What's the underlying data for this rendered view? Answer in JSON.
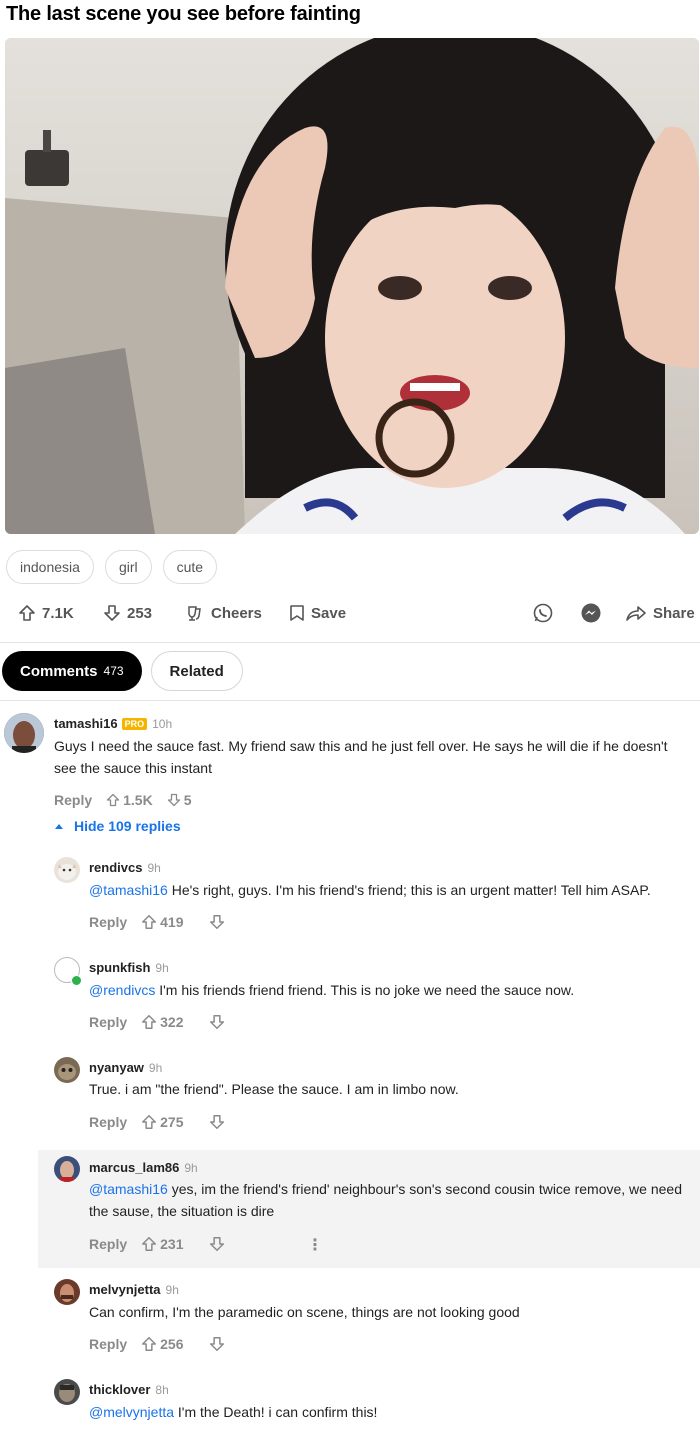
{
  "post": {
    "title": "The last scene you see before fainting",
    "tags": [
      "indonesia",
      "girl",
      "cute"
    ]
  },
  "actions": {
    "upvotes": "7.1K",
    "downvotes": "253",
    "cheers_label": "Cheers",
    "save_label": "Save",
    "share_label": "Share"
  },
  "tabs": {
    "comments_label": "Comments",
    "comments_count": "473",
    "related_label": "Related"
  },
  "comments": [
    {
      "user": "tamashi16",
      "badge": "PRO",
      "time": "10h",
      "text": "Guys I need the sauce fast. My friend saw this and he just fell over. He says he will die if he doesn't see the sauce this instant",
      "reply_label": "Reply",
      "up": "1.5K",
      "down": "5"
    }
  ],
  "hide_replies_label": "Hide 109 replies",
  "replies": [
    {
      "user": "rendivcs",
      "time": "9h",
      "mention": "@tamashi16",
      "text": " He's right, guys. I'm his friend's friend; this is an urgent matter! Tell him ASAP.",
      "reply_label": "Reply",
      "up": "419"
    },
    {
      "user": "spunkfish",
      "time": "9h",
      "mention": "@rendivcs",
      "text": " I'm his friends friend friend. This is no joke we need the sauce now.",
      "reply_label": "Reply",
      "up": "322"
    },
    {
      "user": "nyanyaw",
      "time": "9h",
      "mention": "",
      "text": "True. i am \"the friend\". Please the sauce. I am in limbo now.",
      "reply_label": "Reply",
      "up": "275"
    },
    {
      "user": "marcus_lam86",
      "time": "9h",
      "mention": "@tamashi16",
      "text": " yes, im the friend's friend' neighbour's son's second cousin twice remove, we need the sause, the situation is dire",
      "reply_label": "Reply",
      "up": "231"
    },
    {
      "user": "melvynjetta",
      "time": "9h",
      "mention": "",
      "text": "Can confirm, I'm the paramedic on scene, things are not looking good",
      "reply_label": "Reply",
      "up": "256"
    },
    {
      "user": "thicklover",
      "time": "8h",
      "mention": "@melvynjetta",
      "text": " I'm the Death! i can confirm this!",
      "reply_label": "Reply",
      "up": ""
    }
  ],
  "colors": {
    "accent": "#1a73e8",
    "pro_badge": "#f5b400",
    "online": "#2bb24c"
  }
}
